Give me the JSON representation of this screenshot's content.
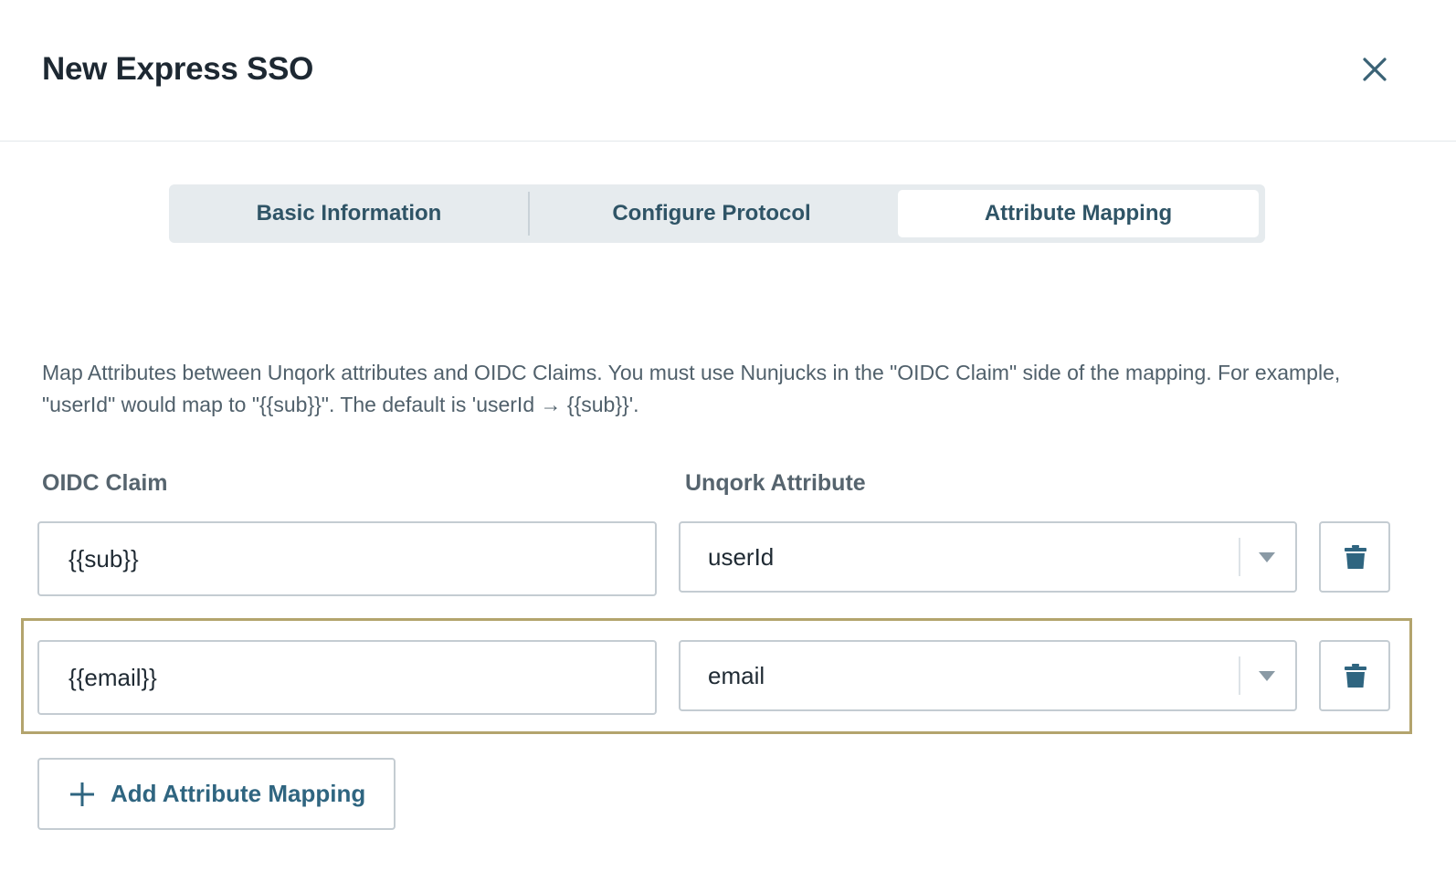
{
  "modal": {
    "title": "New Express SSO",
    "close_icon": "close-icon"
  },
  "tabs": [
    {
      "label": "Basic Information",
      "active": false
    },
    {
      "label": "Configure Protocol",
      "active": false
    },
    {
      "label": "Attribute Mapping",
      "active": true
    }
  ],
  "description": "Map Attributes between Unqork attributes and OIDC Claims. You must use Nunjucks in the \"OIDC Claim\" side of the mapping. For example, \"userId\" would map to \"{{sub}}\". The default is 'userId → {{sub}}'.",
  "columns": {
    "oidc_claim": "OIDC Claim",
    "unqork_attribute": "Unqork Attribute"
  },
  "mappings": [
    {
      "oidc_claim": "{{sub}}",
      "unqork_attribute": "userId",
      "delete_icon": "trash-icon"
    },
    {
      "oidc_claim": "{{email}}",
      "unqork_attribute": "email",
      "delete_icon": "trash-icon",
      "highlighted": true
    }
  ],
  "add_button": {
    "label": "Add Attribute Mapping",
    "icon": "plus-icon"
  },
  "colors": {
    "accent": "#2f6580",
    "highlight_border": "#b3a46d",
    "tab_bg": "#e6ebee"
  }
}
